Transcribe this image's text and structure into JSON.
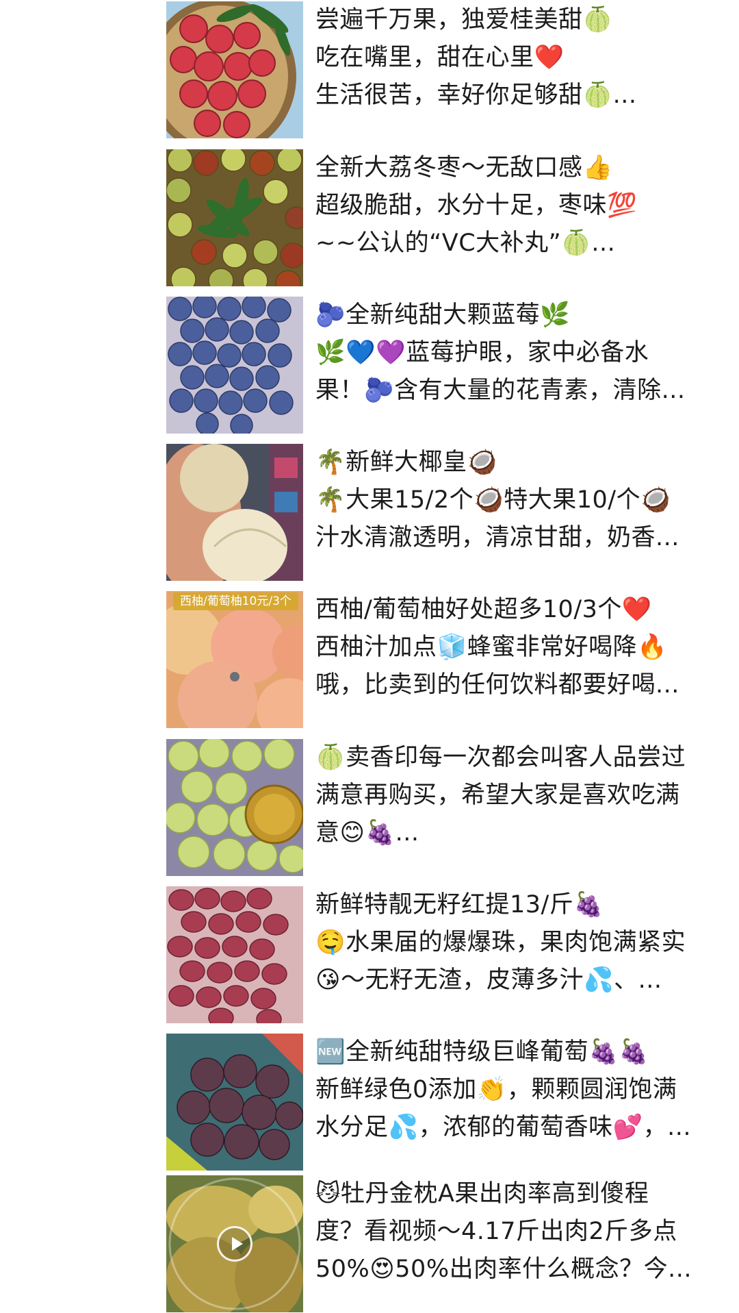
{
  "posts": [
    {
      "image": "lychee-basket-photo",
      "lines": [
        "尝遍千万果，独爱桂美甜🍈",
        "吃在嘴里，甜在心里❤️",
        "生活很苦，幸好你足够甜🍈..."
      ]
    },
    {
      "image": "winter-jujube-photo",
      "lines": [
        "全新大荔冬枣～无敌口感👍",
        "超级脆甜，水分十足，枣味💯",
        "~~公认的“VC大补丸”🍈..."
      ]
    },
    {
      "image": "blueberries-photo",
      "lines": [
        "🫐全新纯甜大颗蓝莓🌿",
        "🌿💙💜蓝莓护眼，家中必备水",
        "果！🫐含有大量的花青素，清除..."
      ]
    },
    {
      "image": "coconut-photo",
      "lines": [
        "🌴新鲜大椰皇🥥",
        "🌴大果15/2个🥥特大果10/个🥥",
        "汁水清澈透明，清凉甘甜，奶香..."
      ]
    },
    {
      "image": "grapefruit-photo",
      "overlay_label": "西柚/葡萄柚10元/3个",
      "lines": [
        "西柚/葡萄柚好处超多10/3个❤️",
        "西柚汁加点🧊蜂蜜非常好喝降🔥",
        "哦，比卖到的任何饮料都要好喝..."
      ]
    },
    {
      "image": "shine-muscat-grapes-photo",
      "lines": [
        "🍈卖香印每一次都会叫客人品尝过",
        "满意再购买，希望大家是喜欢吃满",
        "意😊🍇..."
      ]
    },
    {
      "image": "red-globe-grapes-photo",
      "lines": [
        "新鲜特靓无籽红提13/斤🍇",
        "🤤水果届的爆爆珠，果肉饱满紧实",
        "😘～无籽无渣，皮薄多汁💦、..."
      ]
    },
    {
      "image": "kyoho-grapes-photo",
      "lines": [
        "🆕全新纯甜特级巨峰葡萄🍇🍇",
        "新鲜绿色0添加👏，颗颗圆润饱满",
        "水分足💦，浓郁的葡萄香味💕，..."
      ]
    },
    {
      "image": "durian-video-thumbnail",
      "play_icon": "play-icon",
      "lines": [
        "😼牡丹金枕A果出肉率高到傻程",
        "度？看视频～4.17斤出肉2斤多点",
        "50%😍50%出肉率什么概念？今..."
      ]
    }
  ]
}
